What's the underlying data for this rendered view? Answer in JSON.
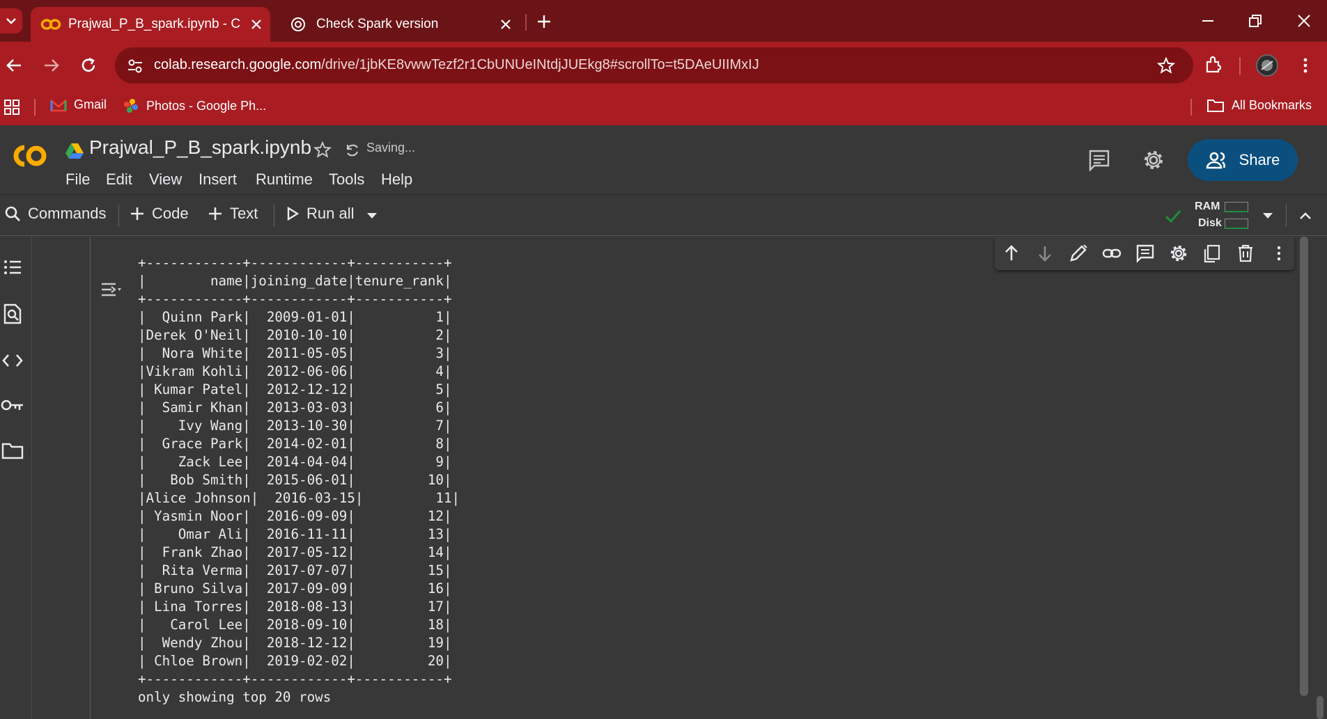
{
  "browser": {
    "tabs": [
      {
        "title": "Prajwal_P_B_spark.ipynb - Colab"
      },
      {
        "title": "Check Spark version"
      }
    ],
    "url_host": "colab.research.google.com",
    "url_path": "/drive/1jbKE8vwwTezf2r1CbUNUeINtdjJUEkg8#scrollTo=t5DAeUIIMxIJ",
    "bookmarks": [
      {
        "label": "Gmail"
      },
      {
        "label": "Photos - Google Ph..."
      }
    ],
    "all_bookmarks": "All Bookmarks"
  },
  "colab": {
    "file_name": "Prajwal_P_B_spark.ipynb",
    "status": "Saving...",
    "menu": [
      "File",
      "Edit",
      "View",
      "Insert",
      "Runtime",
      "Tools",
      "Help"
    ],
    "share_label": "Share",
    "toolbar": {
      "commands": "Commands",
      "code": "Code",
      "text": "Text",
      "run_all": "Run all"
    },
    "resources": {
      "ram": "RAM",
      "disk": "Disk"
    }
  },
  "cell_output": {
    "lines": [
      "+------------+------------+-----------+",
      "|        name|joining_date|tenure_rank|",
      "+------------+------------+-----------+",
      "|  Quinn Park|  2009-01-01|          1|",
      "|Derek O'Neil|  2010-10-10|          2|",
      "|  Nora White|  2011-05-05|          3|",
      "|Vikram Kohli|  2012-06-06|          4|",
      "| Kumar Patel|  2012-12-12|          5|",
      "|  Samir Khan|  2013-03-03|          6|",
      "|    Ivy Wang|  2013-10-30|          7|",
      "|  Grace Park|  2014-02-01|          8|",
      "|    Zack Lee|  2014-04-04|          9|",
      "|   Bob Smith|  2015-06-01|         10|",
      "|Alice Johnson|  2016-03-15|         11|",
      "| Yasmin Noor|  2016-09-09|         12|",
      "|    Omar Ali|  2016-11-11|         13|",
      "|  Frank Zhao|  2017-05-12|         14|",
      "|  Rita Verma|  2017-07-07|         15|",
      "| Bruno Silva|  2017-09-09|         16|",
      "| Lina Torres|  2018-08-13|         17|",
      "|   Carol Lee|  2018-09-10|         18|",
      "|  Wendy Zhou|  2018-12-12|         19|",
      "| Chloe Brown|  2019-02-02|         20|",
      "+------------+------------+-----------+",
      "only showing top 20 rows"
    ]
  }
}
